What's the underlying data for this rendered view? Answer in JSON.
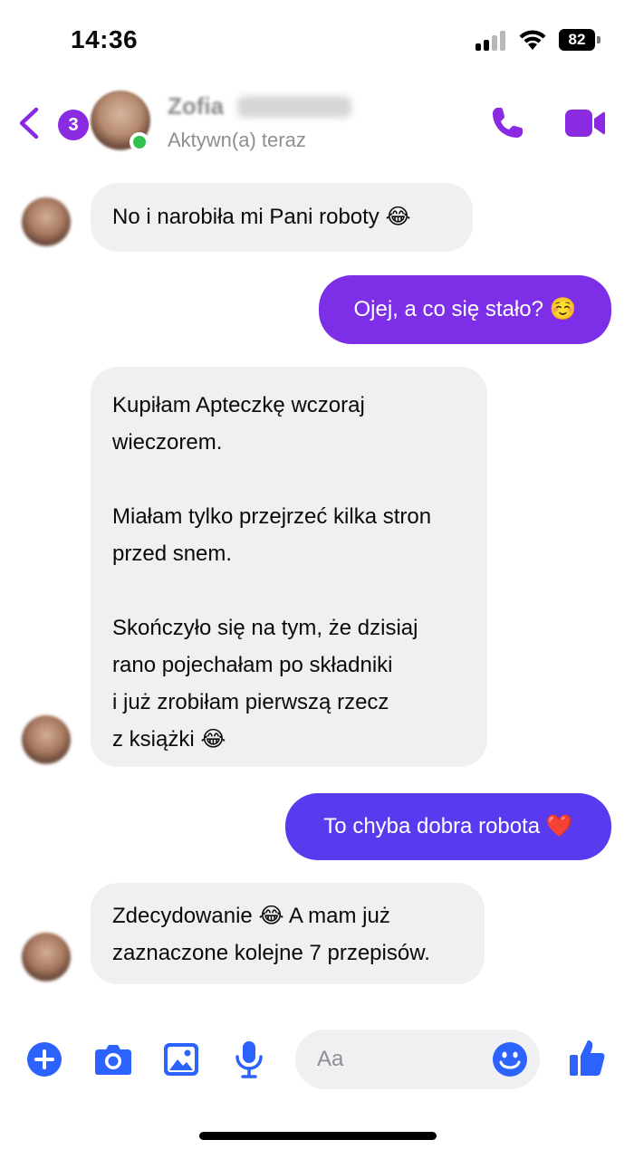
{
  "status_bar": {
    "time": "14:36",
    "battery": "82"
  },
  "header": {
    "back_badge": "3",
    "contact_name": "Zofia",
    "contact_status": "Aktywn(a) teraz"
  },
  "messages": [
    {
      "direction": "incoming",
      "text": "No i narobiła mi Pani roboty",
      "emoji": "😂"
    },
    {
      "direction": "outgoing",
      "text": "Ojej, a co się stało?",
      "emoji": "☺️"
    },
    {
      "direction": "incoming",
      "text": "Kupiłam Apteczkę wczoraj\nwieczorem.\n\nMiałam tylko przejrzeć kilka stron\nprzed snem.\n\nSkończyło się na tym, że dzisiaj\nrano pojechałam po składniki\ni już zrobiłam pierwszą rzecz\nz książki",
      "emoji": "😂"
    },
    {
      "direction": "outgoing",
      "text": "To chyba dobra robota",
      "emoji": "❤️"
    },
    {
      "direction": "incoming",
      "text": "Zdecydowanie",
      "emoji": "😂",
      "text_after": "A mam już\nzaznaczone kolejne 7 przepisów."
    }
  ],
  "composer": {
    "placeholder": "Aa"
  },
  "colors": {
    "accent": "#8a2be2",
    "outgoing_bubble_1": "#7d2fe8",
    "outgoing_bubble_2": "#5a3aee",
    "composer_blue": "#2c63ff",
    "incoming_bubble": "#f0f0f2"
  },
  "icons": [
    "chevron-left-icon",
    "phone-icon",
    "video-camera-icon",
    "plus-icon",
    "camera-icon",
    "image-icon",
    "microphone-icon",
    "smiley-icon",
    "thumbs-up-icon"
  ]
}
